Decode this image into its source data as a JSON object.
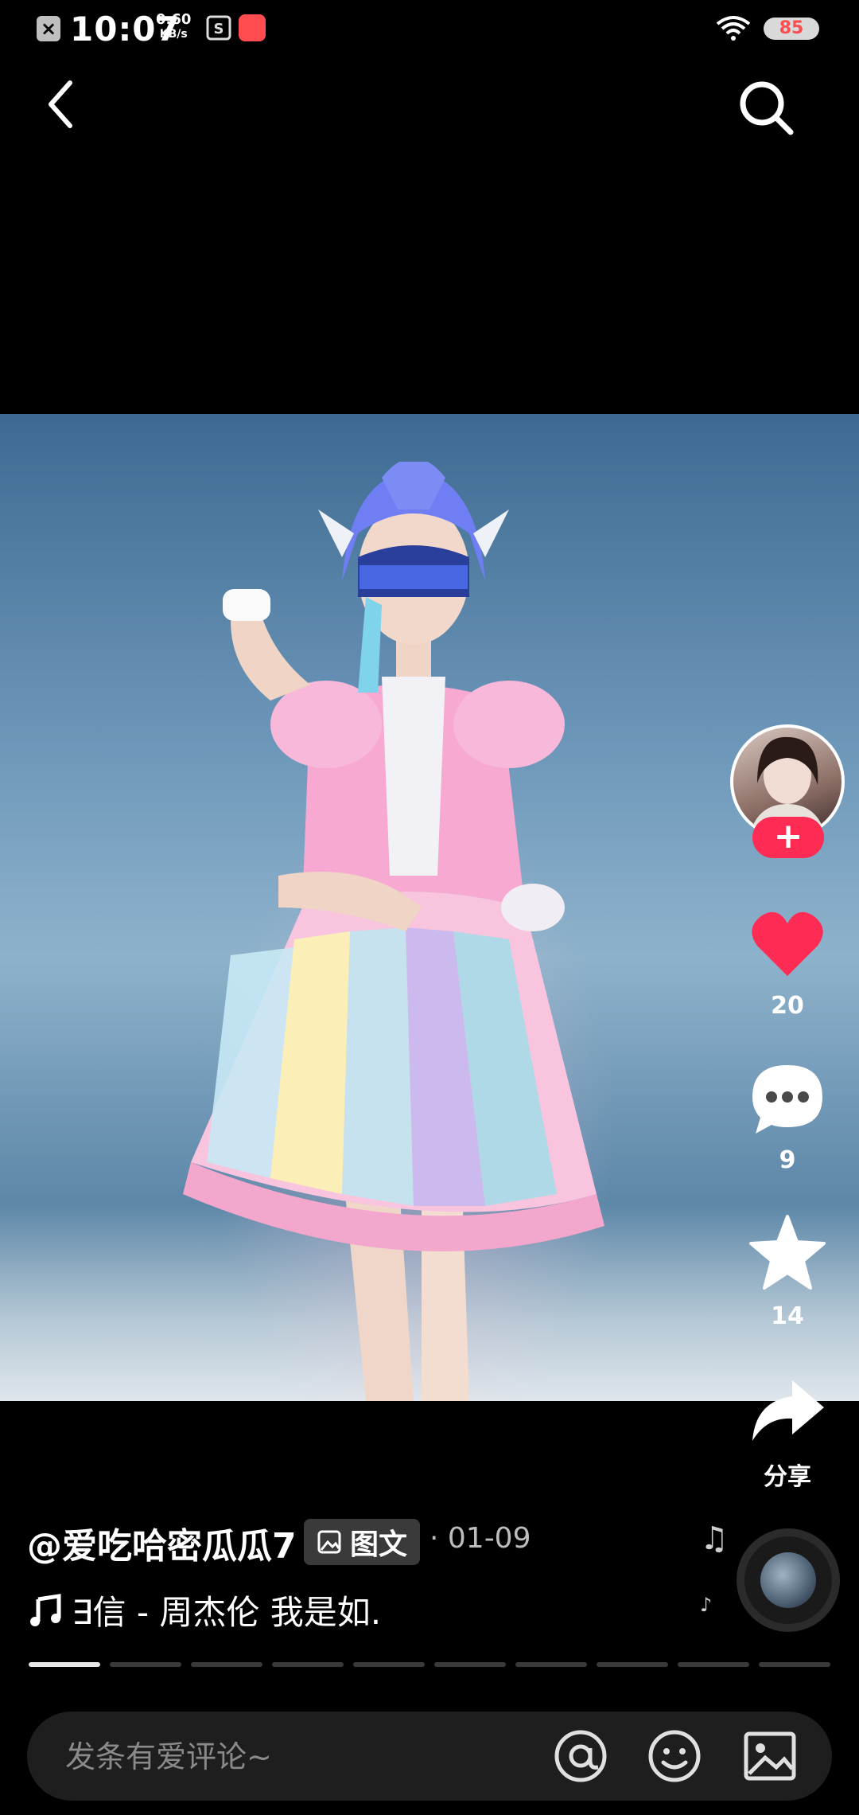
{
  "status_bar": {
    "time": "10:07",
    "net_speed_value": "0.60",
    "net_speed_unit": "KB/s",
    "battery": "85",
    "icons": [
      "x-notification-icon",
      "s-app-icon",
      "kuaishou-app-icon",
      "wifi-icon",
      "battery-icon"
    ]
  },
  "top_bar": {
    "back_icon": "chevron-left-icon",
    "search_icon": "search-icon"
  },
  "right_rail": {
    "follow_label": "+",
    "like_count": "20",
    "comment_count": "9",
    "favorite_count": "14",
    "share_label": "分享",
    "like_color": "#fe2c55"
  },
  "post": {
    "author": "@爱吃哈密瓜瓜7",
    "tag_label": "图文",
    "date": "· 01-09",
    "music_text": "∃信 - 周杰伦     我是如."
  },
  "pager": {
    "total_pages": 10,
    "current_page": 1
  },
  "comment_bar": {
    "placeholder": "发条有爱评论~",
    "icons": [
      "at-icon",
      "emoji-icon",
      "image-icon"
    ]
  },
  "colors": {
    "accent": "#fe2c55",
    "background": "#000000"
  }
}
